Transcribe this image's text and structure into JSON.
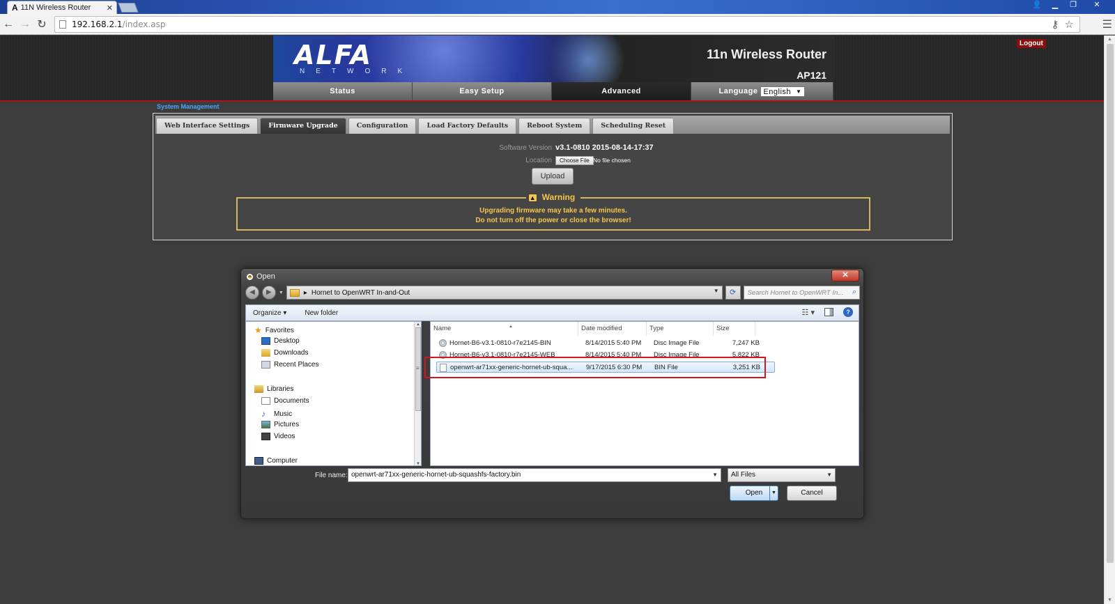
{
  "browser": {
    "tab_title": "11N Wireless Router",
    "tab_icon": "A",
    "tab_close": "✕",
    "url_host": "192.168.2.1",
    "url_path": "/index.asp"
  },
  "router": {
    "logout_label": "Logout",
    "brand": "ALFA",
    "brand_sub": "NETWORK",
    "product_title": "11n Wireless Router",
    "model": "AP121",
    "nav": {
      "status": "Status",
      "easy_setup": "Easy Setup",
      "advanced": "Advanced",
      "language_label": "Language",
      "language_value": "English"
    },
    "breadcrumb": "System Management",
    "subtabs": [
      "Web Interface Settings",
      "Firmware Upgrade",
      "Configuration",
      "Load Factory Defaults",
      "Reboot System",
      "Scheduling Reset"
    ],
    "active_subtab": "Firmware Upgrade",
    "software_version_label": "Software Version",
    "software_version_value": "v3.1-0810 2015-08-14-17:37",
    "location_label": "Location",
    "choose_file_label": "Choose File",
    "no_file_label": "No file chosen",
    "upload_label": "Upload",
    "warning_title": "Warning",
    "warning_line1": "Upgrading firmware may take a few minutes.",
    "warning_line2": "Do not turn off the power or close the browser!"
  },
  "dialog": {
    "title": "Open",
    "close_label": "✕",
    "path": "Hornet to OpenWRT In-and-Out",
    "search_placeholder": "Search Hornet to OpenWRT In...",
    "organize_label": "Organize ▾",
    "new_folder_label": "New folder",
    "nav": {
      "favorites": "Favorites",
      "desktop": "Desktop",
      "downloads": "Downloads",
      "recent_places": "Recent Places",
      "libraries": "Libraries",
      "documents": "Documents",
      "music": "Music",
      "pictures": "Pictures",
      "videos": "Videos",
      "computer": "Computer"
    },
    "columns": {
      "name": "Name",
      "date": "Date modified",
      "type": "Type",
      "size": "Size"
    },
    "files": [
      {
        "name": "Hornet-B6-v3.1-0810-r7e2145-BIN",
        "date": "8/14/2015 5:40 PM",
        "type": "Disc Image File",
        "size": "7,247 KB"
      },
      {
        "name": "Hornet-B6-v3.1-0810-r7e2145-WEB",
        "date": "8/14/2015 5:40 PM",
        "type": "Disc Image File",
        "size": "5,822 KB"
      },
      {
        "name": "openwrt-ar71xx-generic-hornet-ub-squa...",
        "date": "9/17/2015 6:30 PM",
        "type": "BIN File",
        "size": "3,251 KB"
      }
    ],
    "file_name_label": "File name:",
    "file_name_value": "openwrt-ar71xx-generic-hornet-ub-squashfs-factory.bin",
    "file_type_value": "All Files",
    "open_label": "Open",
    "cancel_label": "Cancel"
  }
}
